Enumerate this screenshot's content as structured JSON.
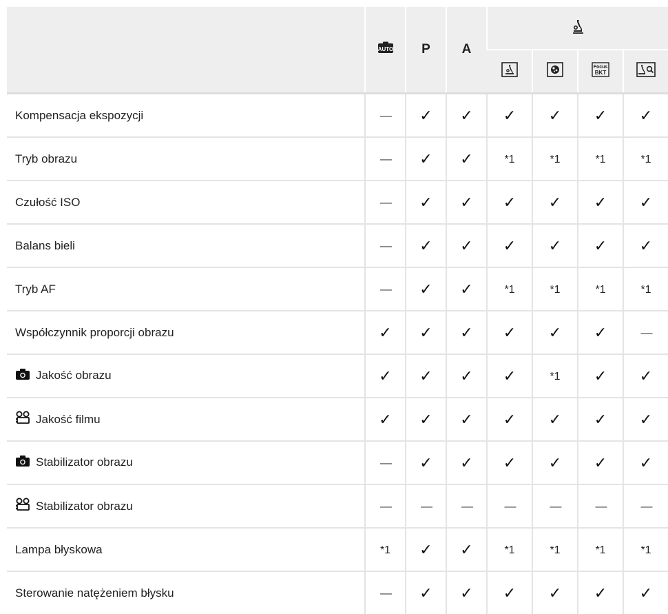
{
  "header": {
    "group_icon": "microscope-mode-icon",
    "cols": [
      {
        "kind": "icon",
        "icon": "auto-mode-icon"
      },
      {
        "kind": "text",
        "text": "P"
      },
      {
        "kind": "text",
        "text": "A"
      },
      {
        "kind": "icon",
        "icon": "microscope-icon"
      },
      {
        "kind": "icon",
        "icon": "depth-composite-icon"
      },
      {
        "kind": "icon",
        "icon": "focus-bkt-icon",
        "text": "Focus BKT"
      },
      {
        "kind": "icon",
        "icon": "microscope-magnify-icon"
      }
    ]
  },
  "rows": [
    {
      "label": "Kompensacja ekspozycji",
      "icon": "",
      "values": [
        "—",
        "✓",
        "✓",
        "✓",
        "✓",
        "✓",
        "✓"
      ]
    },
    {
      "label": "Tryb obrazu",
      "icon": "",
      "values": [
        "—",
        "✓",
        "✓",
        "*1",
        "*1",
        "*1",
        "*1"
      ]
    },
    {
      "label": "Czułość ISO",
      "icon": "",
      "values": [
        "—",
        "✓",
        "✓",
        "✓",
        "✓",
        "✓",
        "✓"
      ]
    },
    {
      "label": "Balans bieli",
      "icon": "",
      "values": [
        "—",
        "✓",
        "✓",
        "✓",
        "✓",
        "✓",
        "✓"
      ]
    },
    {
      "label": "Tryb AF",
      "icon": "",
      "values": [
        "—",
        "✓",
        "✓",
        "*1",
        "*1",
        "*1",
        "*1"
      ]
    },
    {
      "label": "Współczynnik proporcji obrazu",
      "icon": "",
      "values": [
        "✓",
        "✓",
        "✓",
        "✓",
        "✓",
        "✓",
        "—"
      ]
    },
    {
      "label": "Jakość obrazu",
      "icon": "camera-icon",
      "values": [
        "✓",
        "✓",
        "✓",
        "✓",
        "*1",
        "✓",
        "✓"
      ]
    },
    {
      "label": "Jakość filmu",
      "icon": "movie-camera-icon",
      "values": [
        "✓",
        "✓",
        "✓",
        "✓",
        "✓",
        "✓",
        "✓"
      ]
    },
    {
      "label": "Stabilizator obrazu",
      "icon": "camera-icon",
      "values": [
        "—",
        "✓",
        "✓",
        "✓",
        "✓",
        "✓",
        "✓"
      ]
    },
    {
      "label": "Stabilizator obrazu",
      "icon": "movie-camera-icon",
      "values": [
        "—",
        "—",
        "—",
        "—",
        "—",
        "—",
        "—"
      ]
    },
    {
      "label": "Lampa błyskowa",
      "icon": "",
      "values": [
        "*1",
        "✓",
        "✓",
        "*1",
        "*1",
        "*1",
        "*1"
      ]
    },
    {
      "label": "Sterowanie natężeniem błysku",
      "icon": "",
      "values": [
        "—",
        "✓",
        "✓",
        "✓",
        "✓",
        "✓",
        "✓"
      ]
    }
  ]
}
